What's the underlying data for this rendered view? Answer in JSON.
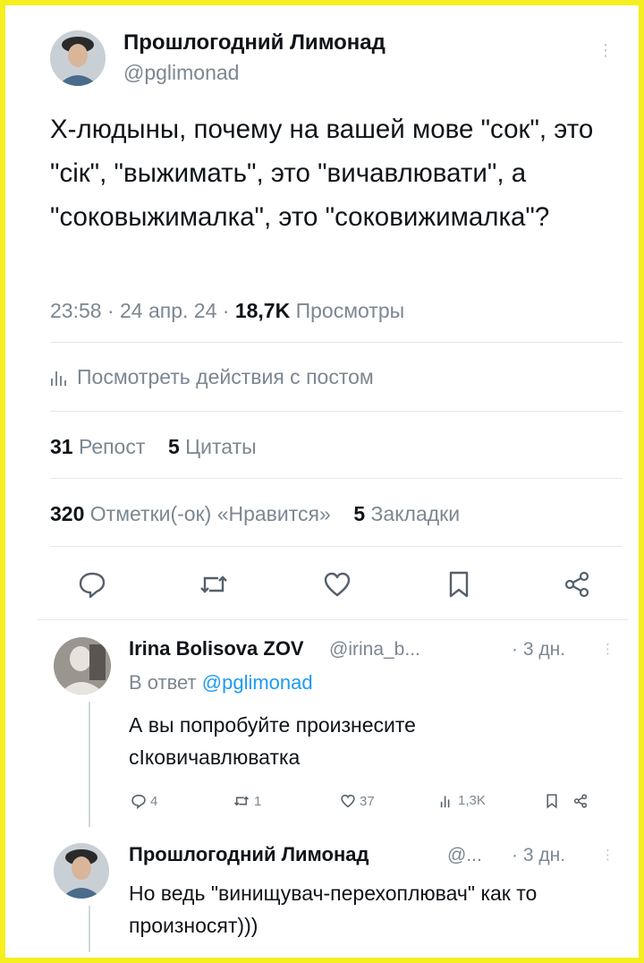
{
  "frame": {
    "border_color": "#f6ef1f"
  },
  "tweet": {
    "author_name": "Прошлогодний Лимонад",
    "handle": "@pglimonad",
    "text": "Х-людыны, почему на вашей мове \"сок\", это \"сік\", \"выжимать\", это \"вичавлювати\", а \"соковыжималка\", это \"соковижималка\"?",
    "time_date": "23:58 · 24 апр. 24 ·",
    "views_count": "18,7K",
    "views_label": "Просмотры",
    "activity_link": "Посмотреть действия с постом",
    "reposts_count": "31",
    "reposts_label": "Репост",
    "quotes_count": "5",
    "quotes_label": "Цитаты",
    "likes_count": "320",
    "likes_label": "Отметки(-ок) «Нравится»",
    "bookmarks_count": "5",
    "bookmarks_label": "Закладки"
  },
  "replies": [
    {
      "author_name": "Irina Bolisova ZOV",
      "handle": "@irina_b...",
      "time": "· 3 дн.",
      "reply_to_prefix": "В ответ",
      "reply_to_handle": "@pglimonad",
      "text": "А вы попробуйте произнесите сІковичавлюватка",
      "replies_count": "4",
      "reposts_count": "1",
      "likes_count": "37",
      "views_count": "1,3K"
    },
    {
      "author_name": "Прошлогодний Лимонад",
      "handle": "@...",
      "time": "· 3 дн.",
      "text": "Но ведь \"винищувач-перехоплювач\" как то произносят)))"
    }
  ],
  "colors": {
    "link": "#1d9bf0",
    "muted": "#7b8792",
    "text": "#0f1419"
  }
}
